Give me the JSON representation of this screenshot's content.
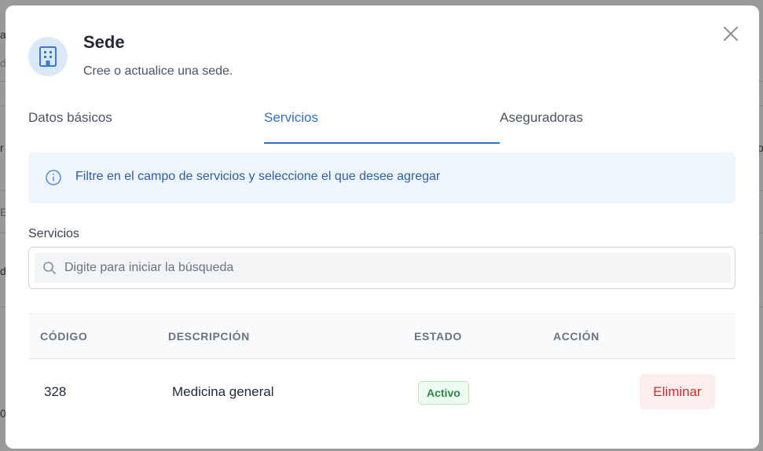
{
  "backdrop": {
    "fragments": [
      "a",
      "d",
      "r",
      "E",
      "d",
      "0",
      "p"
    ]
  },
  "modal": {
    "title": "Sede",
    "subtitle": "Cree o actualice una sede.",
    "icon": "building-icon",
    "close_icon": "close-icon"
  },
  "tabs": [
    {
      "label": "Datos básicos",
      "active": false
    },
    {
      "label": "Servicios",
      "active": true
    },
    {
      "label": "Aseguradoras",
      "active": false
    }
  ],
  "alert": {
    "icon": "info-icon",
    "text": "Filtre en el campo de servicios y seleccione el que desee agregar"
  },
  "search": {
    "label": "Servicios",
    "placeholder": "Digite para iniciar la búsqueda",
    "value": ""
  },
  "table": {
    "headers": [
      "CÓDIGO",
      "DESCRIPCIÓN",
      "ESTADO",
      "ACCIÓN"
    ],
    "rows": [
      {
        "code": "328",
        "description": "Medicina general",
        "status": "Activo",
        "action": "Eliminar"
      }
    ]
  },
  "colors": {
    "accent": "#2f6fd0",
    "status_active": "#2b8a46",
    "danger": "#d02a2a",
    "alert_bg": "#eef5fc"
  }
}
